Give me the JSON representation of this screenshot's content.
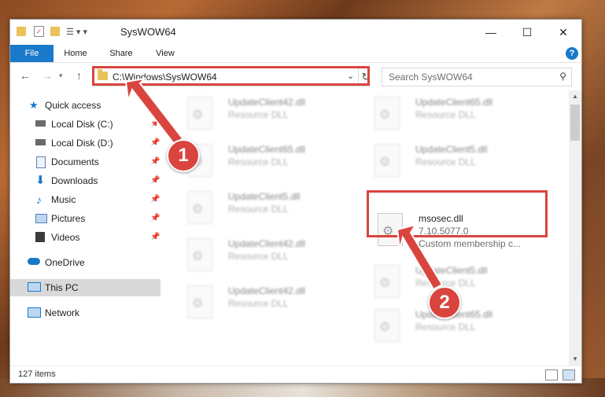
{
  "window": {
    "title": "SysWOW64",
    "controls": {
      "minimize": "—",
      "maximize": "☐",
      "close": "✕"
    }
  },
  "ribbon": {
    "tabs": [
      "File",
      "Home",
      "Share",
      "View"
    ],
    "help": "?"
  },
  "address": {
    "path": "C:\\Windows\\SysWOW64",
    "search_placeholder": "Search SysWOW64"
  },
  "sidebar": {
    "quick_access": "Quick access",
    "items": [
      {
        "label": "Local Disk (C:)",
        "icon": "drive-icon"
      },
      {
        "label": "Local Disk (D:)",
        "icon": "drive-icon"
      },
      {
        "label": "Documents",
        "icon": "documents-icon"
      },
      {
        "label": "Downloads",
        "icon": "downloads-icon"
      },
      {
        "label": "Music",
        "icon": "music-icon"
      },
      {
        "label": "Pictures",
        "icon": "pictures-icon"
      },
      {
        "label": "Videos",
        "icon": "videos-icon"
      }
    ],
    "onedrive": "OneDrive",
    "this_pc": "This PC",
    "network": "Network"
  },
  "files": [
    {
      "name": "UpdateClient42.dll",
      "type": "Resource DLL"
    },
    {
      "name": "UpdateClient65.dll",
      "type": "Resource DLL"
    },
    {
      "name": "UpdateClient65.dll",
      "type": "Resource DLL"
    },
    {
      "name": "UpdateClient5.dll",
      "type": "Resource DLL"
    },
    {
      "name": "UpdateClient5.dll",
      "type": "Resource DLL"
    },
    {
      "name": "msosec.dll",
      "version": "7.10.5077.0",
      "description": "Custom membership c..."
    },
    {
      "name": "UpdateClient42.dll",
      "type": "Resource DLL"
    },
    {
      "name": "UpdateClient5.dll",
      "type": "Resource DLL"
    },
    {
      "name": "UpdateClient42.dll",
      "type": "Resource DLL"
    },
    {
      "name": "UpdateClient65.dll",
      "type": "Resource DLL"
    }
  ],
  "status": {
    "count": "127 items"
  },
  "annotations": {
    "step1": "1",
    "step2": "2"
  },
  "colors": {
    "accent": "#1979ca",
    "highlight": "#d9453e"
  }
}
